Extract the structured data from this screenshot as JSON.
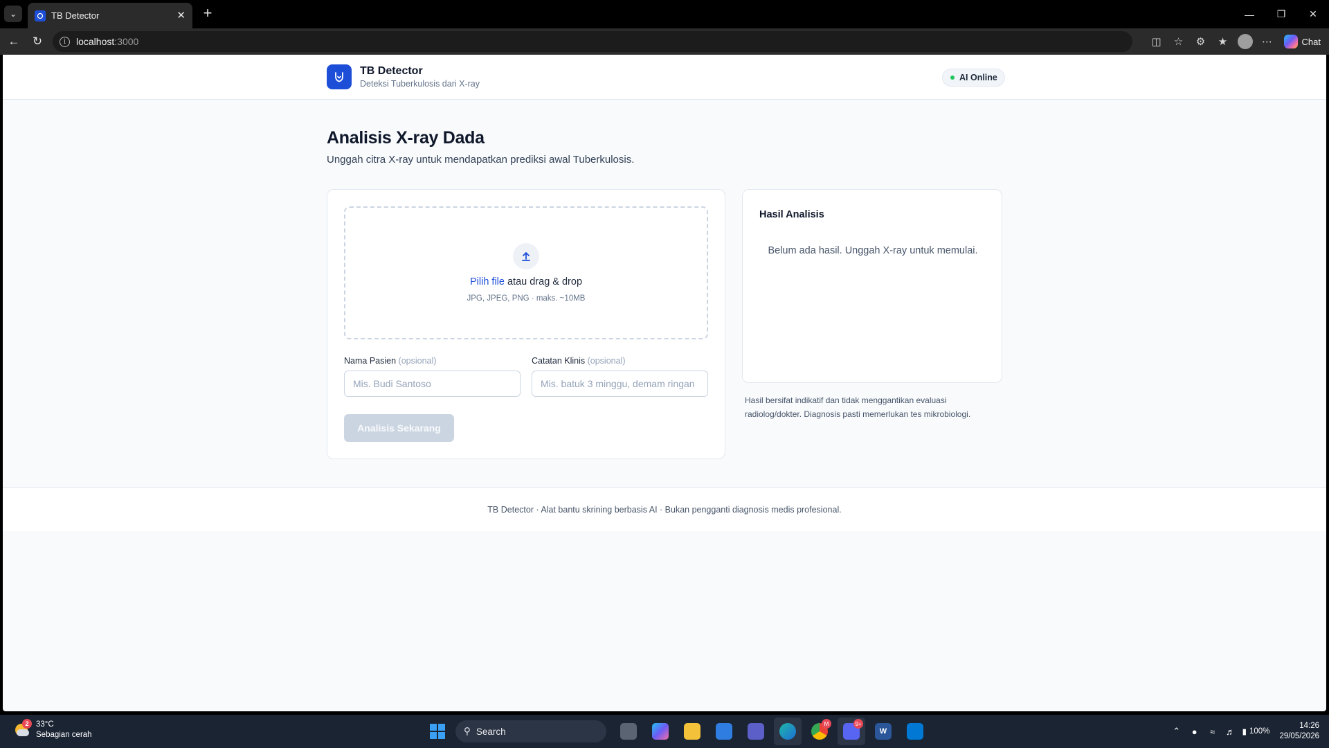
{
  "browser": {
    "tab_title": "TB Detector",
    "url_host": "localhost",
    "url_port": ":3000",
    "chat_label": "Chat"
  },
  "app": {
    "name": "TB Detector",
    "tagline": "Deteksi Tuberkulosis dari X-ray",
    "status": "AI Online",
    "status_color": "#22c55e",
    "accent_color": "#1d4ed8"
  },
  "page": {
    "title": "Analisis X-ray Dada",
    "subtitle": "Unggah citra X-ray untuk mendapatkan prediksi awal Tuberkulosis."
  },
  "upload": {
    "link_text": "Pilih file",
    "rest_text": " atau drag & drop",
    "hint": "JPG, JPEG, PNG · maks. ~10MB",
    "patient_label": "Nama Pasien",
    "patient_optional": "(opsional)",
    "patient_placeholder": "Mis. Budi Santoso",
    "notes_label": "Catatan Klinis",
    "notes_optional": "(opsional)",
    "notes_placeholder": "Mis. batuk 3 minggu, demam ringan",
    "analyze_label": "Analisis Sekarang"
  },
  "result": {
    "title": "Hasil Analisis",
    "empty_text": "Belum ada hasil. Unggah X-ray untuk memulai.",
    "disclaimer": "Hasil bersifat indikatif dan tidak menggantikan evaluasi radiolog/dokter. Diagnosis pasti memerlukan tes mikrobiologi."
  },
  "footer": {
    "text": "TB Detector · Alat bantu skrining berbasis AI · Bukan pengganti diagnosis medis profesional."
  },
  "taskbar": {
    "weather_temp": "33°C",
    "weather_desc": "Sebagian cerah",
    "weather_badge": "2",
    "search_label": "Search",
    "chrome_badge": "M",
    "discord_badge": "9+",
    "battery": "100%",
    "time": "14:26",
    "date": "29/05/2026"
  }
}
